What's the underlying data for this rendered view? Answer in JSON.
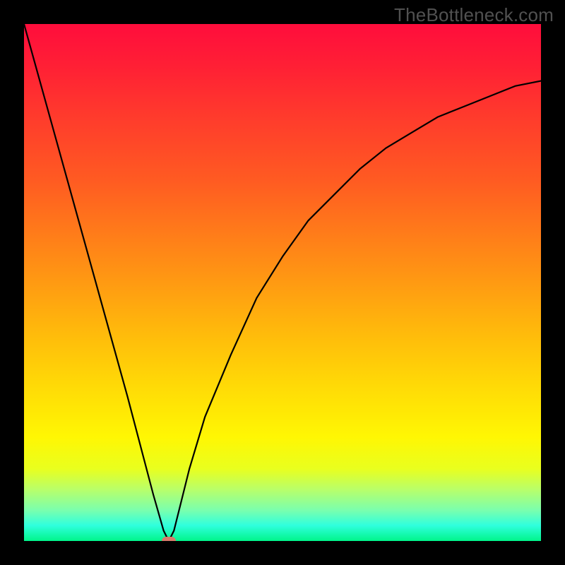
{
  "watermark": "TheBottleneck.com",
  "chart_data": {
    "type": "line",
    "title": "",
    "xlabel": "",
    "ylabel": "",
    "xlim": [
      0,
      100
    ],
    "ylim": [
      0,
      100
    ],
    "x": [
      0,
      5,
      10,
      15,
      20,
      25,
      27,
      28,
      29,
      30,
      32,
      35,
      40,
      45,
      50,
      55,
      60,
      65,
      70,
      75,
      80,
      85,
      90,
      95,
      100
    ],
    "y": [
      100,
      82,
      64,
      46,
      28,
      9,
      2,
      0,
      2,
      6,
      14,
      24,
      36,
      47,
      55,
      62,
      67,
      72,
      76,
      79,
      82,
      84,
      86,
      88,
      89
    ],
    "marker": {
      "x": 28,
      "y": 0
    },
    "colors": {
      "curve": "#000000",
      "marker": "#d87a6a",
      "frame": "#000000",
      "gradient_top": "#ff0d3c",
      "gradient_bottom": "#00f58a"
    }
  }
}
